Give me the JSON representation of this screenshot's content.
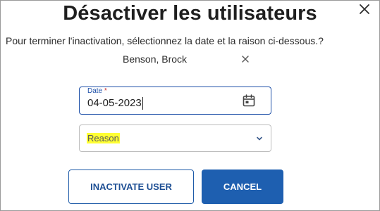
{
  "dialog": {
    "title": "Désactiver les utilisateurs",
    "subtitle": "Pour terminer l'inactivation, sélectionnez la date et la raison ci-dessous.?",
    "close_icon": "close-icon"
  },
  "selected_user": {
    "name": "Benson, Brock",
    "remove_icon": "close-icon"
  },
  "date_field": {
    "label": "Date",
    "required_marker": "*",
    "value": "04-05-2023",
    "icon": "calendar-icon"
  },
  "reason_field": {
    "placeholder": "Reason",
    "icon": "chevron-down-icon"
  },
  "actions": {
    "inactivate_label": "INACTIVATE USER",
    "cancel_label": "CANCEL"
  },
  "colors": {
    "primary": "#1e5fb0",
    "outline_focus": "#1e50a8",
    "highlight": "#ffff33",
    "required": "#c62828"
  }
}
